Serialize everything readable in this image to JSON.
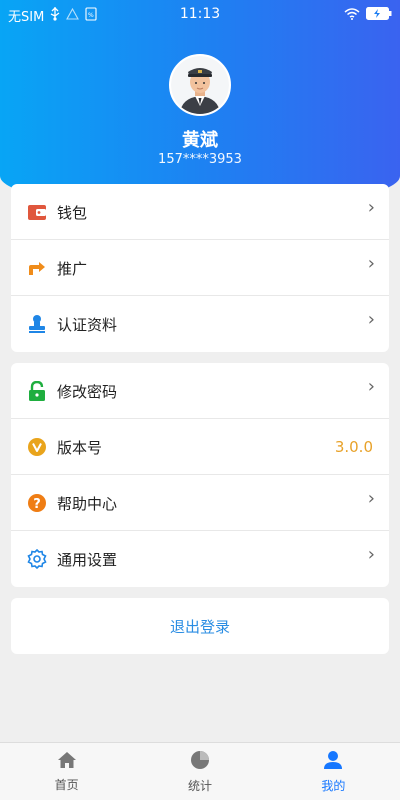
{
  "status_bar": {
    "carrier": "无SIM",
    "time": "11:13",
    "icons": [
      "usb-icon",
      "warning-icon",
      "vpn-icon",
      "wifi-icon",
      "battery-icon"
    ]
  },
  "profile": {
    "name": "黄斌",
    "phone": "157****3953",
    "avatar_icon": "driver-avatar-icon"
  },
  "menu_group_1": [
    {
      "label": "钱包",
      "icon": "wallet-icon"
    },
    {
      "label": "推广",
      "icon": "share-icon"
    },
    {
      "label": "认证资料",
      "icon": "certification-icon"
    }
  ],
  "menu_group_2": [
    {
      "label": "修改密码",
      "icon": "lock-icon"
    },
    {
      "label": "版本号",
      "icon": "version-icon",
      "value": "3.0.0"
    },
    {
      "label": "帮助中心",
      "icon": "help-icon"
    },
    {
      "label": "通用设置",
      "icon": "settings-icon"
    }
  ],
  "logout_label": "退出登录",
  "tabs": [
    {
      "label": "首页",
      "icon": "home-icon"
    },
    {
      "label": "统计",
      "icon": "pie-chart-icon"
    },
    {
      "label": "我的",
      "icon": "user-icon"
    }
  ],
  "colors": {
    "header_start": "#08a5f5",
    "header_end": "#3a63f0",
    "accent": "#1677ff",
    "version_value": "#e8a22a"
  }
}
